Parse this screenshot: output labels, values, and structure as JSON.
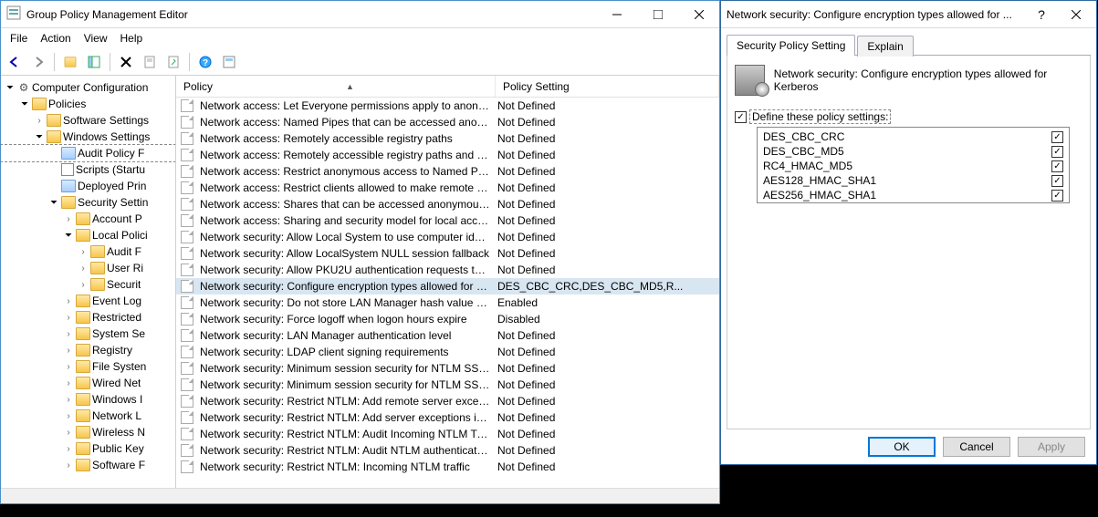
{
  "main": {
    "title": "Group Policy Management Editor",
    "menu": [
      "File",
      "Action",
      "View",
      "Help"
    ],
    "tree": [
      {
        "ind": 0,
        "chev": "open",
        "icon": "gear",
        "label": "Computer Configuration"
      },
      {
        "ind": 1,
        "chev": "open",
        "icon": "folder",
        "label": "Policies"
      },
      {
        "ind": 2,
        "chev": "closed",
        "icon": "folder",
        "label": "Software Settings"
      },
      {
        "ind": 2,
        "chev": "open",
        "icon": "folder",
        "label": "Windows Settings"
      },
      {
        "ind": 3,
        "chev": "",
        "icon": "folder-special",
        "label": "Audit Policy F",
        "sel": true
      },
      {
        "ind": 3,
        "chev": "",
        "icon": "doc",
        "label": "Scripts (Startu"
      },
      {
        "ind": 3,
        "chev": "",
        "icon": "folder-special",
        "label": "Deployed Prin"
      },
      {
        "ind": 3,
        "chev": "open",
        "icon": "folder",
        "label": "Security Settin"
      },
      {
        "ind": 4,
        "chev": "closed",
        "icon": "folder",
        "label": "Account P"
      },
      {
        "ind": 4,
        "chev": "open",
        "icon": "folder",
        "label": "Local Polici"
      },
      {
        "ind": 5,
        "chev": "closed",
        "icon": "folder",
        "label": "Audit F"
      },
      {
        "ind": 5,
        "chev": "closed",
        "icon": "folder",
        "label": "User Ri"
      },
      {
        "ind": 5,
        "chev": "closed",
        "icon": "folder",
        "label": "Securit"
      },
      {
        "ind": 4,
        "chev": "closed",
        "icon": "folder",
        "label": "Event Log"
      },
      {
        "ind": 4,
        "chev": "closed",
        "icon": "folder",
        "label": "Restricted"
      },
      {
        "ind": 4,
        "chev": "closed",
        "icon": "folder",
        "label": "System Se"
      },
      {
        "ind": 4,
        "chev": "closed",
        "icon": "folder",
        "label": "Registry"
      },
      {
        "ind": 4,
        "chev": "closed",
        "icon": "folder",
        "label": "File Systen"
      },
      {
        "ind": 4,
        "chev": "closed",
        "icon": "folder",
        "label": "Wired Net"
      },
      {
        "ind": 4,
        "chev": "closed",
        "icon": "folder",
        "label": "Windows I"
      },
      {
        "ind": 4,
        "chev": "closed",
        "icon": "folder",
        "label": "Network L"
      },
      {
        "ind": 4,
        "chev": "closed",
        "icon": "folder",
        "label": "Wireless N"
      },
      {
        "ind": 4,
        "chev": "closed",
        "icon": "folder",
        "label": "Public Key"
      },
      {
        "ind": 4,
        "chev": "closed",
        "icon": "folder",
        "label": "Software F"
      }
    ],
    "columns": [
      "Policy",
      "Policy Setting"
    ],
    "rows": [
      {
        "p": "Network access: Let Everyone permissions apply to anonym...",
        "s": "Not Defined"
      },
      {
        "p": "Network access: Named Pipes that can be accessed anonym...",
        "s": "Not Defined"
      },
      {
        "p": "Network access: Remotely accessible registry paths",
        "s": "Not Defined"
      },
      {
        "p": "Network access: Remotely accessible registry paths and sub...",
        "s": "Not Defined"
      },
      {
        "p": "Network access: Restrict anonymous access to Named Pipes...",
        "s": "Not Defined"
      },
      {
        "p": "Network access: Restrict clients allowed to make remote call...",
        "s": "Not Defined"
      },
      {
        "p": "Network access: Shares that can be accessed anonymously",
        "s": "Not Defined"
      },
      {
        "p": "Network access: Sharing and security model for local accou...",
        "s": "Not Defined"
      },
      {
        "p": "Network security: Allow Local System to use computer ident...",
        "s": "Not Defined"
      },
      {
        "p": "Network security: Allow LocalSystem NULL session fallback",
        "s": "Not Defined"
      },
      {
        "p": "Network security: Allow PKU2U authentication requests to t...",
        "s": "Not Defined"
      },
      {
        "p": "Network security: Configure encryption types allowed for Ke...",
        "s": "DES_CBC_CRC,DES_CBC_MD5,R...",
        "sel": true
      },
      {
        "p": "Network security: Do not store LAN Manager hash value on ...",
        "s": "Enabled"
      },
      {
        "p": "Network security: Force logoff when logon hours expire",
        "s": "Disabled"
      },
      {
        "p": "Network security: LAN Manager authentication level",
        "s": "Not Defined"
      },
      {
        "p": "Network security: LDAP client signing requirements",
        "s": "Not Defined"
      },
      {
        "p": "Network security: Minimum session security for NTLM SSP ...",
        "s": "Not Defined"
      },
      {
        "p": "Network security: Minimum session security for NTLM SSP ...",
        "s": "Not Defined"
      },
      {
        "p": "Network security: Restrict NTLM: Add remote server excepti...",
        "s": "Not Defined"
      },
      {
        "p": "Network security: Restrict NTLM: Add server exceptions in t...",
        "s": "Not Defined"
      },
      {
        "p": "Network security: Restrict NTLM: Audit Incoming NTLM Tra...",
        "s": "Not Defined"
      },
      {
        "p": "Network security: Restrict NTLM: Audit NTLM authenticatio...",
        "s": "Not Defined"
      },
      {
        "p": "Network security: Restrict NTLM: Incoming NTLM traffic",
        "s": "Not Defined"
      }
    ]
  },
  "dialog": {
    "title": "Network security: Configure encryption types allowed for ...",
    "tabs": [
      "Security Policy Setting",
      "Explain"
    ],
    "header": "Network security: Configure encryption types allowed for Kerberos",
    "define_label": "Define these policy settings:",
    "options": [
      {
        "name": "DES_CBC_CRC",
        "checked": true
      },
      {
        "name": "DES_CBC_MD5",
        "checked": true
      },
      {
        "name": "RC4_HMAC_MD5",
        "checked": true
      },
      {
        "name": "AES128_HMAC_SHA1",
        "checked": true
      },
      {
        "name": "AES256_HMAC_SHA1",
        "checked": true
      }
    ],
    "buttons": {
      "ok": "OK",
      "cancel": "Cancel",
      "apply": "Apply"
    }
  }
}
